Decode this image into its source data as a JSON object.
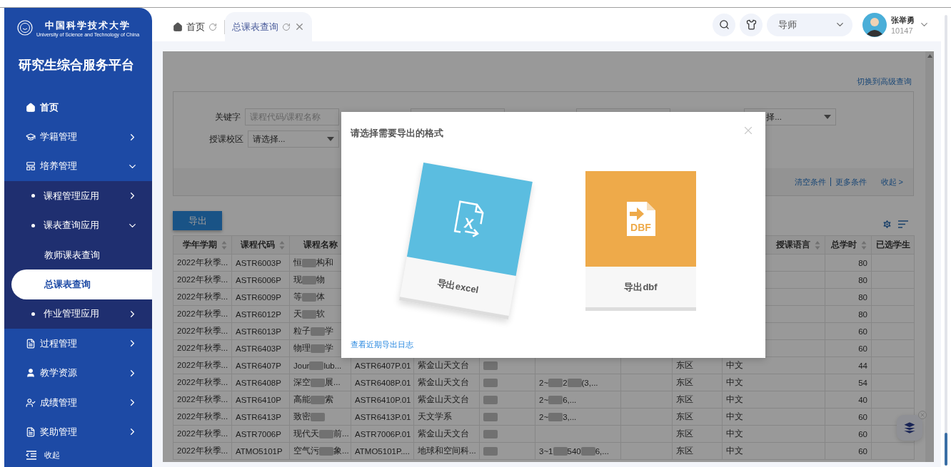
{
  "logo": {
    "name": "中国科学技术大学",
    "subtitle": "University of Science and Technology of China"
  },
  "platform_title": "研究生综合服务平台",
  "menu": [
    {
      "label": "首页",
      "selected": false
    },
    {
      "label": "学籍管理",
      "selected": false,
      "expanded": false
    },
    {
      "label": "培养管理",
      "selected": false,
      "expanded": true,
      "children": [
        {
          "label": "课程管理应用",
          "selected": false,
          "expanded": false
        },
        {
          "label": "课表查询应用",
          "selected": false,
          "expanded": true,
          "children": [
            {
              "label": "教师课表查询",
              "selected": false
            },
            {
              "label": "总课表查询",
              "selected": true
            }
          ]
        },
        {
          "label": "作业管理应用",
          "selected": false,
          "expanded": false
        }
      ]
    },
    {
      "label": "过程管理",
      "selected": false,
      "expanded": false
    },
    {
      "label": "教学资源",
      "selected": false,
      "expanded": false
    },
    {
      "label": "成绩管理",
      "selected": false,
      "expanded": false
    },
    {
      "label": "奖助管理",
      "selected": false,
      "expanded": false
    }
  ],
  "collapse_label": "收起",
  "tabs": [
    {
      "label": "首页",
      "selected": false,
      "closable": false
    },
    {
      "label": "总课表查询",
      "selected": true,
      "closable": true
    }
  ],
  "role": "导师",
  "user": {
    "name": "张举勇",
    "id": "10147"
  },
  "query": {
    "advanced_link": "切换到高级查询",
    "filters": [
      [
        {
          "kind": "input",
          "label": "关键字",
          "placeholder": "课程代码/课程名称"
        },
        {
          "kind": "input"
        },
        {
          "kind": "input"
        },
        {
          "kind": "select",
          "value": "择..."
        }
      ],
      [
        {
          "kind": "select",
          "label": "授课校区",
          "value": "请选择..."
        }
      ]
    ],
    "footer_links": [
      "清空条件",
      "更多条件"
    ],
    "collapse_link": "收起 >",
    "export_button": "导出"
  },
  "table": {
    "columns": [
      {
        "label": "学年学期",
        "sortable": true
      },
      {
        "label": "课程代码",
        "sortable": true
      },
      {
        "label": "课程名称",
        "sortable": false
      },
      null,
      null,
      null,
      null,
      null,
      null,
      {
        "label": "授课语言",
        "sortable": true
      },
      {
        "label": "总学时",
        "sortable": true
      },
      {
        "label": "已选学生",
        "sortable": false
      }
    ],
    "rows": [
      [
        "2022年秋季...",
        "ASTR6003P",
        [
          "恒",
          {
            "kind": "blur"
          },
          "构和"
        ],
        null,
        null,
        null,
        null,
        null,
        null,
        null,
        "80",
        null
      ],
      [
        "2022年秋季...",
        "ASTR6006P",
        [
          "现",
          {
            "kind": "blur"
          },
          "物"
        ],
        null,
        null,
        null,
        null,
        null,
        null,
        null,
        "80",
        null
      ],
      [
        "2022年秋季...",
        "ASTR6009P",
        [
          "等",
          {
            "kind": "blur"
          },
          "体"
        ],
        null,
        null,
        null,
        null,
        null,
        null,
        null,
        "80",
        null
      ],
      [
        "2022年秋季...",
        "ASTR6012P",
        [
          "天",
          {
            "kind": "blur"
          },
          "软"
        ],
        null,
        null,
        null,
        null,
        null,
        null,
        null,
        "80",
        null
      ],
      [
        "2022年秋季...",
        "ASTR6013P",
        [
          "粒子",
          {
            "kind": "blur"
          },
          "学"
        ],
        null,
        null,
        null,
        null,
        null,
        null,
        null,
        "60",
        null
      ],
      [
        "2022年秋季...",
        "ASTR6403P",
        [
          "物理",
          {
            "kind": "blur"
          },
          "学"
        ],
        null,
        null,
        null,
        null,
        null,
        null,
        null,
        "60",
        null
      ],
      [
        "2022年秋季...",
        "ASTR6407P",
        [
          "Jour",
          {
            "kind": "blur"
          },
          "lub..."
        ],
        "ASTR6407P.01",
        "紫金山天文台",
        [
          {
            "kind": "blur"
          }
        ],
        null,
        null,
        "东区",
        "中文",
        "44",
        null
      ],
      [
        "2022年秋季...",
        "ASTR6408P",
        [
          "深空",
          {
            "kind": "blur"
          },
          "展..."
        ],
        "ASTR6408P.01",
        "紫金山天文台",
        [
          {
            "kind": "blur"
          }
        ],
        [
          "2~",
          {
            "kind": "blur"
          },
          "2",
          {
            "kind": "blur"
          },
          "(3,..."
        ],
        null,
        "东区",
        "中文",
        "54",
        null
      ],
      [
        "2022年秋季...",
        "ASTR6410P",
        [
          "高能",
          {
            "kind": "blur"
          },
          "索"
        ],
        "ASTR6410P.01",
        "紫金山天文台",
        [
          {
            "kind": "blur"
          }
        ],
        [
          "2~",
          {
            "kind": "blur"
          },
          "6,..."
        ],
        null,
        "东区",
        "中文",
        "40",
        null
      ],
      [
        "2022年秋季...",
        "ASTR6413P",
        [
          "致密",
          {
            "kind": "blur"
          }
        ],
        "ASTR6413P.01",
        "天文学系",
        [
          {
            "kind": "blur"
          }
        ],
        [
          "2~",
          {
            "kind": "blur"
          },
          "3,..."
        ],
        null,
        "东区",
        "中文",
        "60",
        null
      ],
      [
        "2022年秋季...",
        "ASTR7006P",
        [
          "现代天",
          {
            "kind": "blur"
          },
          "前..."
        ],
        "ASTR7006P.01",
        "紫金山天文台",
        [
          {
            "kind": "blur"
          }
        ],
        null,
        null,
        "东区",
        "中文",
        "60",
        null
      ],
      [
        "2022年秋季...",
        "ATMO5101P",
        [
          "空气污",
          {
            "kind": "blur"
          },
          "象..."
        ],
        "ATMO5101P....",
        "地球和空间科...",
        [
          {
            "kind": "blur"
          }
        ],
        [
          "3~1",
          {
            "kind": "blur"
          },
          "540",
          {
            "kind": "blur"
          },
          "6,..."
        ],
        null,
        "东区",
        "中文",
        "60",
        null
      ]
    ]
  },
  "modal": {
    "title": "请选择需要导出的格式",
    "options": [
      {
        "kind": "excel",
        "icon_text": "X",
        "label": "导出excel",
        "tilted": true
      },
      {
        "kind": "dbf",
        "icon_text": "DBF",
        "label": "导出dbf",
        "tilted": false
      }
    ],
    "log_link": "查看近期导出日志"
  }
}
